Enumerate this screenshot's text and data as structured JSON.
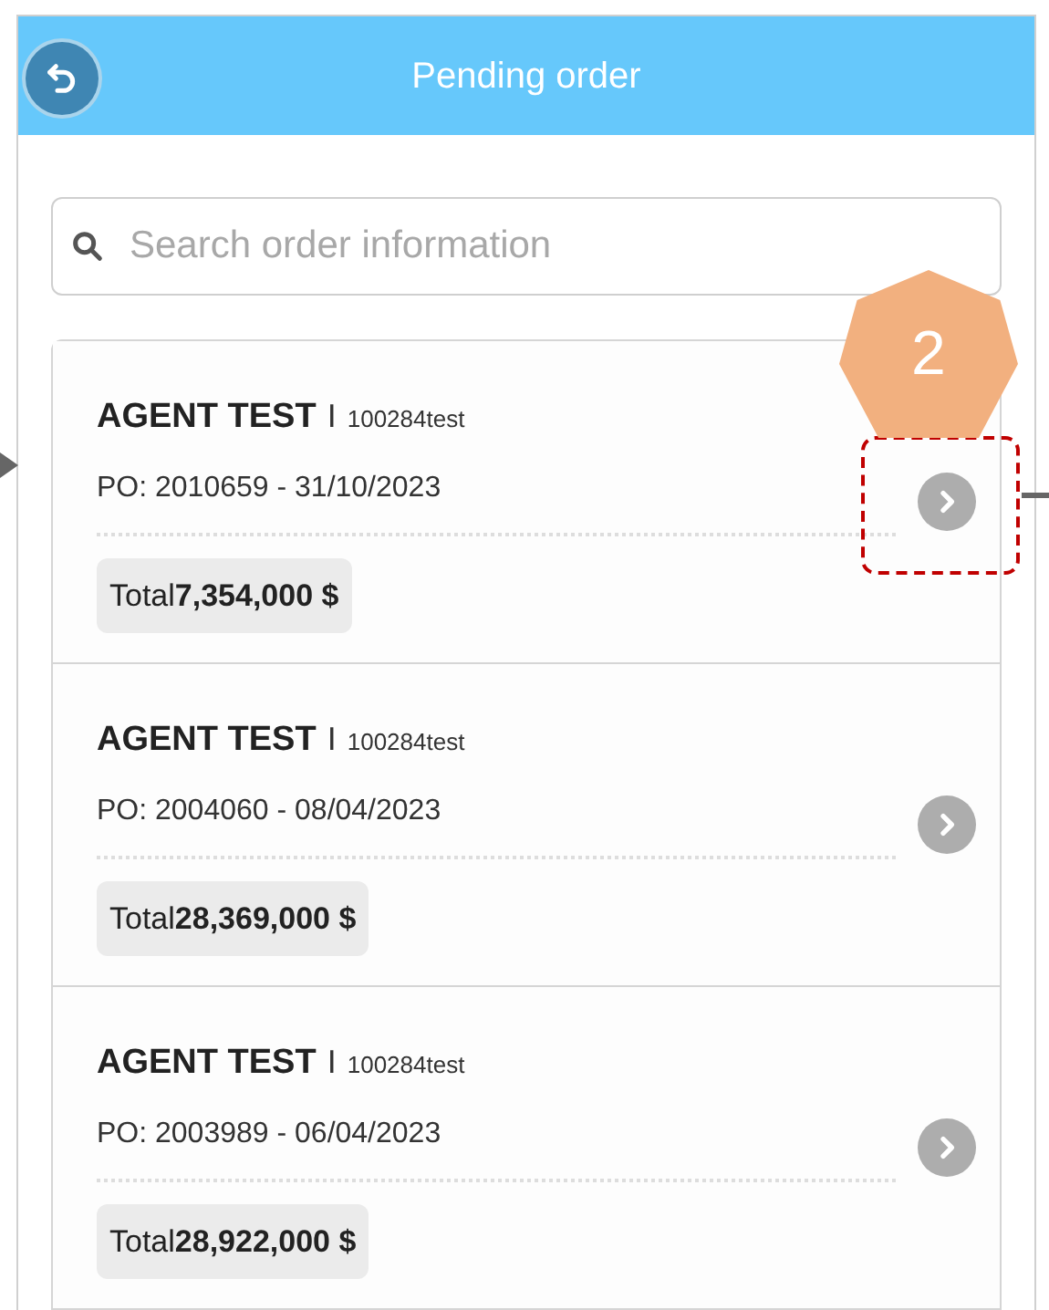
{
  "header": {
    "title": "Pending order"
  },
  "search": {
    "placeholder": "Search order information"
  },
  "orders": [
    {
      "name": "AGENT TEST",
      "separator": "I",
      "code": "100284test",
      "po": "PO: 2010659 - 31/10/2023",
      "total": "Total**7,354,000 $**",
      "highlighted": true
    },
    {
      "name": "AGENT TEST",
      "separator": "I",
      "code": "100284test",
      "po": "PO: 2004060 - 08/04/2023",
      "total": "Total**28,369,000 $**",
      "highlighted": false
    },
    {
      "name": "AGENT TEST",
      "separator": "I",
      "code": "100284test",
      "po": "PO: 2003989 - 06/04/2023",
      "total": "Total**28,922,000 $**",
      "highlighted": false
    }
  ],
  "annotation": {
    "step": "2"
  }
}
